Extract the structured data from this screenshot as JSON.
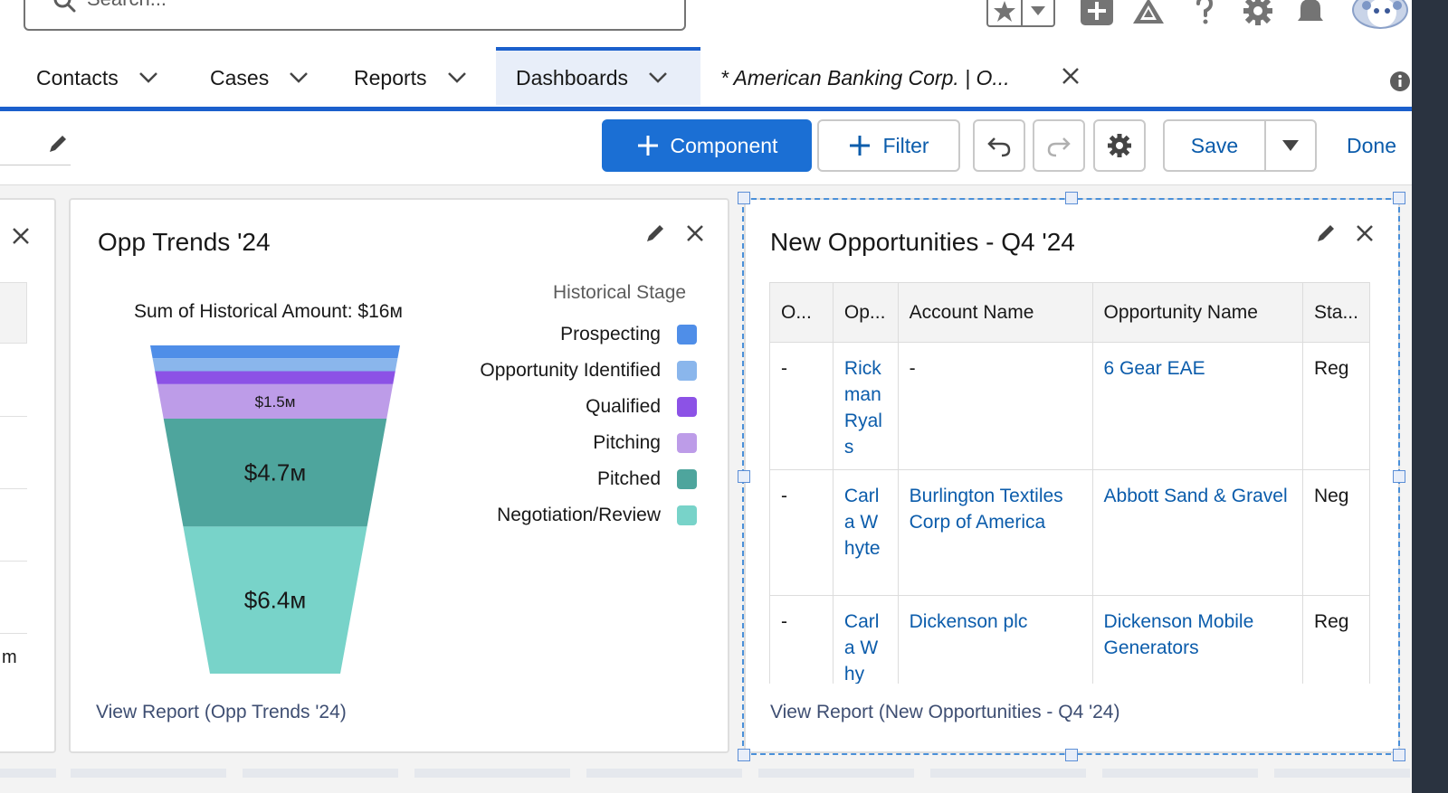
{
  "header": {
    "search_placeholder": "Search...",
    "icons": [
      "favorites-star-icon",
      "favorites-dropdown-icon",
      "global-actions-icon",
      "trailhead-icon",
      "help-icon",
      "setup-gear-icon",
      "notifications-bell-icon",
      "avatar"
    ]
  },
  "nav": {
    "tabs": [
      {
        "label": "Contacts"
      },
      {
        "label": "Cases"
      },
      {
        "label": "Reports"
      },
      {
        "label": "Dashboards"
      },
      {
        "label": "* American Banking Corp. | O..."
      }
    ]
  },
  "toolbar": {
    "component_label": "Component",
    "filter_label": "Filter",
    "save_label": "Save",
    "done_label": "Done"
  },
  "opp_trends": {
    "title": "Opp Trends '24",
    "view_report": "View Report (Opp Trends '24)",
    "chart_data": {
      "type": "funnel",
      "title": "Sum of Historical Amount: $16м",
      "legend_title": "Historical Stage",
      "legend_position": "right",
      "stages": [
        {
          "name": "Prospecting",
          "color": "#4f8ee8",
          "value": 0.3,
          "label": ""
        },
        {
          "name": "Opportunity Identified",
          "color": "#8ab6ec",
          "value": 0.3,
          "label": ""
        },
        {
          "name": "Qualified",
          "color": "#8c52e6",
          "value": 0.4,
          "label": ""
        },
        {
          "name": "Pitching",
          "color": "#bd9ce8",
          "value": 1.5,
          "label": "$1.5м"
        },
        {
          "name": "Pitched",
          "color": "#4ea59d",
          "value": 4.7,
          "label": "$4.7м"
        },
        {
          "name": "Negotiation/Review",
          "color": "#78d3c9",
          "value": 6.4,
          "label": "$6.4м"
        }
      ]
    }
  },
  "new_opps": {
    "title": "New Opportunities - Q4 '24",
    "view_report": "View Report (New Opportunities - Q4 '24)",
    "columns": [
      "O...",
      "Op...",
      "Account Name",
      "Opportunity Name",
      "Sta..."
    ],
    "rows": [
      [
        "-",
        "Rickman Ryals",
        "-",
        "6 Gear EAE",
        "Reg"
      ],
      [
        "-",
        "Carla Whyte",
        "Burlington Textiles Corp of America",
        "Abbott Sand & Gravel",
        "Neg"
      ],
      [
        "-",
        "Carla Why",
        "Dickenson plc",
        "Dickenson Mobile Generators",
        "Reg"
      ]
    ]
  },
  "left_stub": {
    "text": "m"
  }
}
